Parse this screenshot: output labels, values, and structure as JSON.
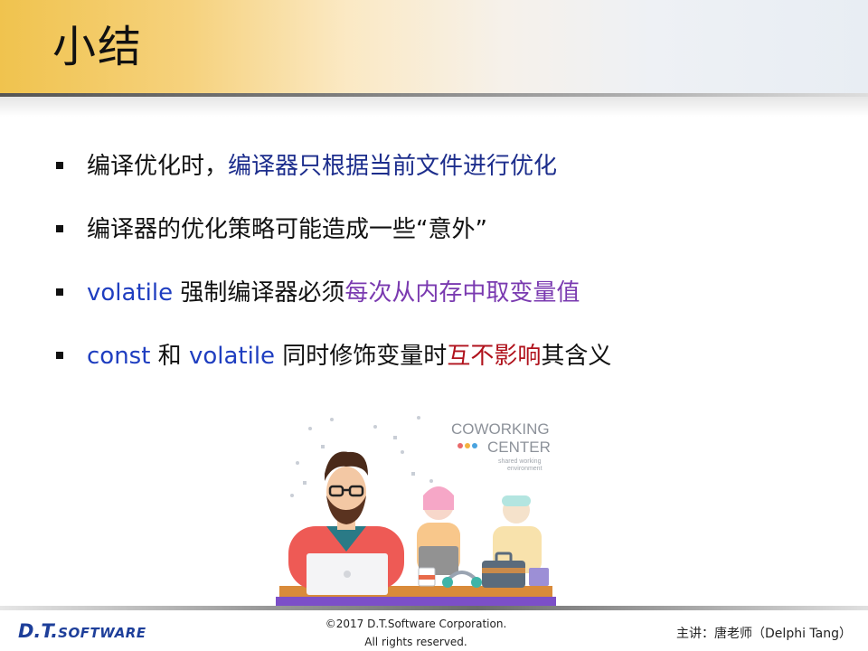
{
  "slide": {
    "title": "小结"
  },
  "bullets": [
    {
      "segments": [
        {
          "text": "编译优化时，",
          "color": "#111111"
        },
        {
          "text": "编译器只根据当前文件进行优化",
          "color": "#1c2d8c"
        }
      ]
    },
    {
      "segments": [
        {
          "text": "编译器的优化策略可能造成一些“意外”",
          "color": "#111111"
        }
      ]
    },
    {
      "segments": [
        {
          "text": "volatile",
          "color": "#1f3ec0"
        },
        {
          "text": " 强制编译器必须",
          "color": "#111111"
        },
        {
          "text": "每次从内存中取变量值",
          "color": "#7a3ab0"
        }
      ]
    },
    {
      "segments": [
        {
          "text": "const",
          "color": "#1f3ec0"
        },
        {
          "text": " 和 ",
          "color": "#111111"
        },
        {
          "text": "volatile",
          "color": "#1f3ec0"
        },
        {
          "text": " 同时修饰变量时",
          "color": "#111111"
        },
        {
          "text": "互不影响",
          "color": "#b0121c"
        },
        {
          "text": "其含义",
          "color": "#111111"
        }
      ]
    }
  ],
  "illustration": {
    "heading_line1": "COWORKING",
    "heading_line2": "CENTER",
    "caption_line1": "shared working",
    "caption_line2": "environment"
  },
  "footer": {
    "logo_main": "D.T.",
    "logo_sub": "SOFTWARE",
    "copyright_line1": "©2017 D.T.Software Corporation.",
    "copyright_line2": "All rights reserved.",
    "lecturer": "主讲：唐老师（Delphi Tang）"
  },
  "colors": {
    "accent_gold": "#f0c34e",
    "keyword_blue": "#1f3ec0",
    "highlight_purple": "#7a3ab0",
    "highlight_red": "#b0121c"
  }
}
